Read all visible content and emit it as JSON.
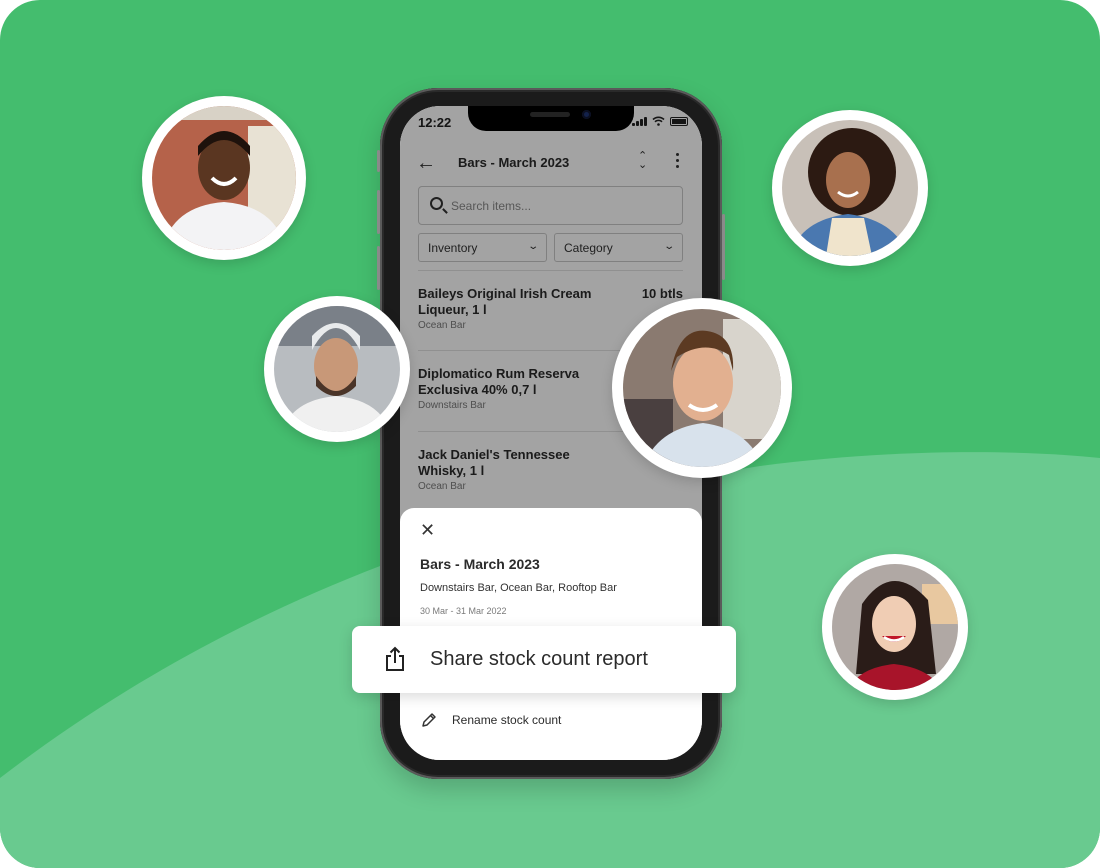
{
  "colors": {
    "background_dark_green": "#44bd6e",
    "background_light_green": "#69ca8f",
    "text_primary": "#2b2b2b",
    "text_secondary": "#7a7a7a"
  },
  "status_bar": {
    "time": "12:22"
  },
  "app_header": {
    "back_icon": "arrow-left-icon",
    "title": "Bars - March 2023",
    "sort_icon": "chevron-up-down-icon",
    "more_icon": "vertical-ellipsis-icon"
  },
  "search": {
    "placeholder": "Search items...",
    "value": ""
  },
  "filters": [
    {
      "label": "Inventory"
    },
    {
      "label": "Category"
    }
  ],
  "items": [
    {
      "name": "Baileys Original Irish Cream Liqueur, 1 l",
      "location": "Ocean Bar",
      "quantity": "10 btls"
    },
    {
      "name": "Diplomatico Rum Reserva Exclusiva 40% 0,7 l",
      "location": "Downstairs Bar",
      "quantity": ""
    },
    {
      "name": "Jack Daniel's Tennessee Whisky, 1 l",
      "location": "Ocean Bar",
      "quantity": ""
    }
  ],
  "bottom_sheet": {
    "close_icon": "close-icon",
    "title": "Bars - March 2023",
    "locations": "Downstairs Bar, Ocean Bar, Rooftop Bar",
    "date_range": "30 Mar - 31 Mar 2022",
    "actions": [
      {
        "icon": "share-icon",
        "label": "Share stock count report"
      },
      {
        "icon": "pencil-icon",
        "label": "Rename stock count"
      }
    ]
  },
  "avatars": [
    {
      "name": "smiling-man-white-shirt"
    },
    {
      "name": "chef-white-hat"
    },
    {
      "name": "young-man-smiling"
    },
    {
      "name": "woman-curly-hair-apron"
    },
    {
      "name": "woman-red-top-laughing"
    }
  ]
}
